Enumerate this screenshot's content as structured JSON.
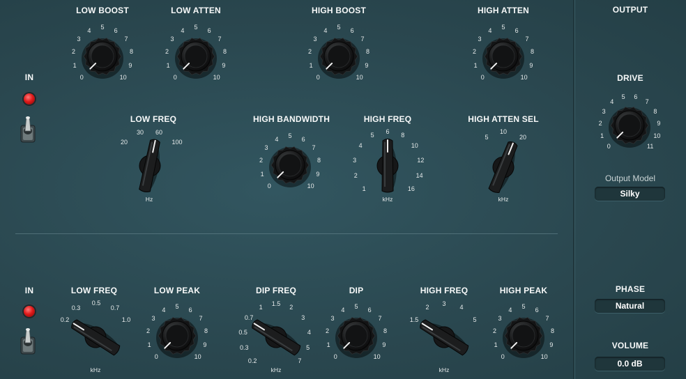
{
  "panel": {
    "upper_in_label": "IN",
    "lower_in_label": "IN"
  },
  "upper": {
    "low_boost": {
      "title": "LOW BOOST",
      "ticks": [
        "0",
        "1",
        "2",
        "3",
        "4",
        "5",
        "6",
        "7",
        "8",
        "9",
        "10"
      ]
    },
    "low_atten": {
      "title": "LOW ATTEN",
      "ticks": [
        "0",
        "1",
        "2",
        "3",
        "4",
        "5",
        "6",
        "7",
        "8",
        "9",
        "10"
      ]
    },
    "high_boost": {
      "title": "HIGH BOOST",
      "ticks": [
        "0",
        "1",
        "2",
        "3",
        "4",
        "5",
        "6",
        "7",
        "8",
        "9",
        "10"
      ]
    },
    "high_atten": {
      "title": "HIGH ATTEN",
      "ticks": [
        "0",
        "1",
        "2",
        "3",
        "4",
        "5",
        "6",
        "7",
        "8",
        "9",
        "10"
      ]
    },
    "low_freq": {
      "title": "LOW FREQ",
      "ticks": [
        "20",
        "30",
        "60",
        "100"
      ],
      "unit": "Hz"
    },
    "high_bandwidth": {
      "title": "HIGH BANDWIDTH",
      "ticks": [
        "0",
        "1",
        "2",
        "3",
        "4",
        "5",
        "6",
        "7",
        "8",
        "9",
        "10"
      ]
    },
    "high_freq": {
      "title": "HIGH FREQ",
      "ticks": [
        "1",
        "2",
        "3",
        "4",
        "5",
        "6",
        "8",
        "10",
        "12",
        "14",
        "16"
      ],
      "unit": "kHz"
    },
    "high_atten_sel": {
      "title": "HIGH ATTEN SEL",
      "ticks": [
        "5",
        "10",
        "20"
      ],
      "unit": "kHz"
    }
  },
  "lower": {
    "low_freq": {
      "title": "LOW FREQ",
      "ticks": [
        "0.2",
        "0.3",
        "0.5",
        "0.7",
        "1.0"
      ],
      "unit": "kHz"
    },
    "low_peak": {
      "title": "LOW PEAK",
      "ticks": [
        "0",
        "1",
        "2",
        "3",
        "4",
        "5",
        "6",
        "7",
        "8",
        "9",
        "10"
      ]
    },
    "dip_freq": {
      "title": "DIP FREQ",
      "ticks": [
        "0.2",
        "0.3",
        "0.5",
        "0.7",
        "1",
        "1.5",
        "2",
        "3",
        "4",
        "5",
        "7"
      ],
      "unit": "kHz"
    },
    "dip": {
      "title": "DIP",
      "ticks": [
        "0",
        "1",
        "2",
        "3",
        "4",
        "5",
        "6",
        "7",
        "8",
        "9",
        "10"
      ]
    },
    "high_freq": {
      "title": "HIGH FREQ",
      "ticks": [
        "1.5",
        "2",
        "3",
        "4",
        "5"
      ],
      "unit": "kHz"
    },
    "high_peak": {
      "title": "HIGH PEAK",
      "ticks": [
        "0",
        "1",
        "2",
        "3",
        "4",
        "5",
        "6",
        "7",
        "8",
        "9",
        "10"
      ]
    }
  },
  "output": {
    "title": "OUTPUT",
    "drive": {
      "title": "DRIVE",
      "ticks": [
        "0",
        "1",
        "2",
        "3",
        "4",
        "5",
        "6",
        "7",
        "8",
        "9",
        "10",
        "11"
      ]
    },
    "model_label": "Output Model",
    "model_value": "Silky",
    "phase_label": "PHASE",
    "phase_value": "Natural",
    "volume_label": "VOLUME",
    "volume_value": "0.0 dB"
  },
  "colors": {
    "background": "#2b4a52",
    "led": "#e01a1a",
    "text": "#f4f6f6"
  }
}
